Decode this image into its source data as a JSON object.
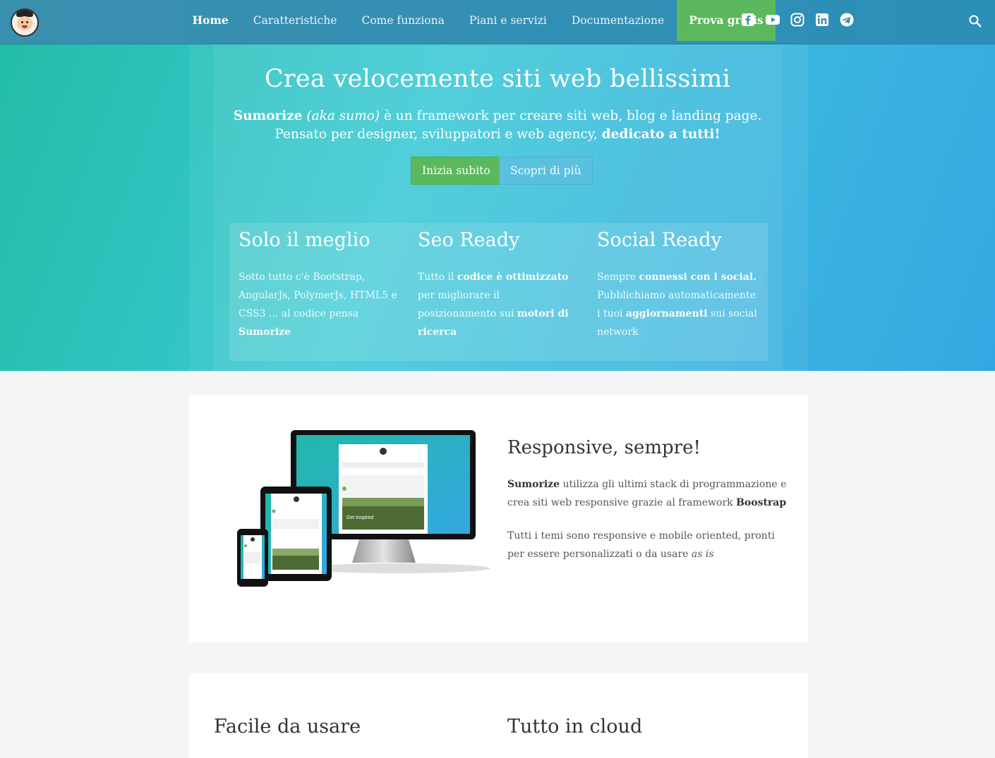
{
  "nav": {
    "items": [
      {
        "label": "Home",
        "active": true
      },
      {
        "label": "Caratteristiche"
      },
      {
        "label": "Come funziona"
      },
      {
        "label": "Piani e servizi"
      },
      {
        "label": "Documentazione"
      }
    ],
    "cta_label": "Prova gratis",
    "social_icons": [
      "facebook-icon",
      "youtube-icon",
      "instagram-icon",
      "linkedin-icon",
      "telegram-icon"
    ],
    "search_icon": "search-icon"
  },
  "hero": {
    "title": "Crea velocemente siti web bellissimi",
    "line1_brand": "Sumorize",
    "line1_aka": "(aka sumo)",
    "line1_rest": " è un framework per creare siti web, blog e landing page.",
    "line2_text": "Pensato per designer, sviluppatori e web agency, ",
    "line2_strong": "dedicato a tutti!",
    "primary_button": "Inizia subito",
    "secondary_button": "Scopri di più"
  },
  "features": [
    {
      "title": "Solo il meglio",
      "text_a": "Sotto tutto c'è Bootstrap, AngularJs, PolymerJs, HTML5 e CSS3 ... al codice pensa ",
      "text_b": "Sumorize"
    },
    {
      "title": "Seo Ready",
      "text_a": "Tutto il ",
      "text_b": "codice è ottimizzato",
      "text_c": " per migliorare il posizionamento sui ",
      "text_d": "motori di ricerca"
    },
    {
      "title": "Social Ready",
      "text_a": "Sempre ",
      "text_b": "connessi con i social.",
      "text_c": " Pubblichiamo automaticamente i tuoi ",
      "text_d": "aggiornamenti",
      "text_e": " sui social network"
    }
  ],
  "responsive": {
    "title": "Responsive, sempre!",
    "p1_brand": "Sumorize",
    "p1_text": " utilizza gli ultimi stack di programmazione e crea siti web responsive grazie al framework ",
    "p1_strong": "Boostrap",
    "p2_text": "Tutti i temi sono responsive e mobile oriented, pronti per essere personalizzati o da usare ",
    "p2_em": "as is",
    "device_caption": "Get Inspired"
  },
  "section2": {
    "col1_title": "Facile da usare",
    "col2_title": "Tutto in cloud"
  },
  "colors": {
    "nav_bg": "#3a8fae",
    "cta_green": "#5cb85c",
    "info_blue": "#5bc0de",
    "hero_gradient_start": "#22bda7",
    "hero_gradient_end": "#34a7e2"
  }
}
